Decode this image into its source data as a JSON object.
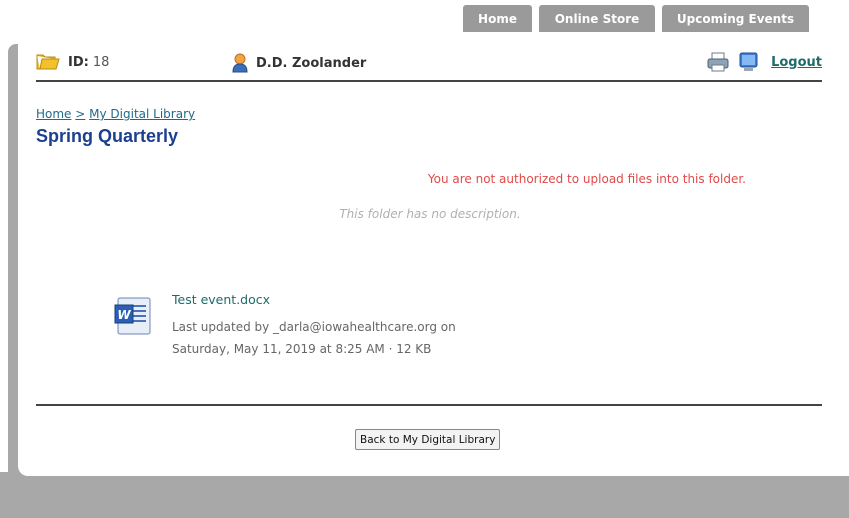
{
  "nav": {
    "tabs": [
      {
        "label": "Home"
      },
      {
        "label": "Online Store"
      },
      {
        "label": "Upcoming Events"
      }
    ]
  },
  "header": {
    "id_label": "ID:",
    "id_value": "18",
    "user_name": "D.D. Zoolander",
    "logout_label": "Logout"
  },
  "breadcrumb": {
    "home": "Home",
    "separator": ">",
    "library": "My Digital Library"
  },
  "page": {
    "title": "Spring Quarterly",
    "error_message": "You are not authorized to upload files into this folder.",
    "folder_description": "This folder has no description."
  },
  "file": {
    "name": "Test event.docx",
    "meta_line1": "Last updated by _darla@iowahealthcare.org on",
    "meta_line2": "Saturday, May 11, 2019 at 8:25 AM · 12 KB",
    "icon": "word-document-icon"
  },
  "footer": {
    "back_button": "Back to My Digital Library"
  },
  "colors": {
    "title": "#1c3f8e",
    "error": "#e24a4a",
    "link": "#1d6b6b",
    "frame": "#a8a8a8",
    "tab": "#9a9a9a"
  }
}
